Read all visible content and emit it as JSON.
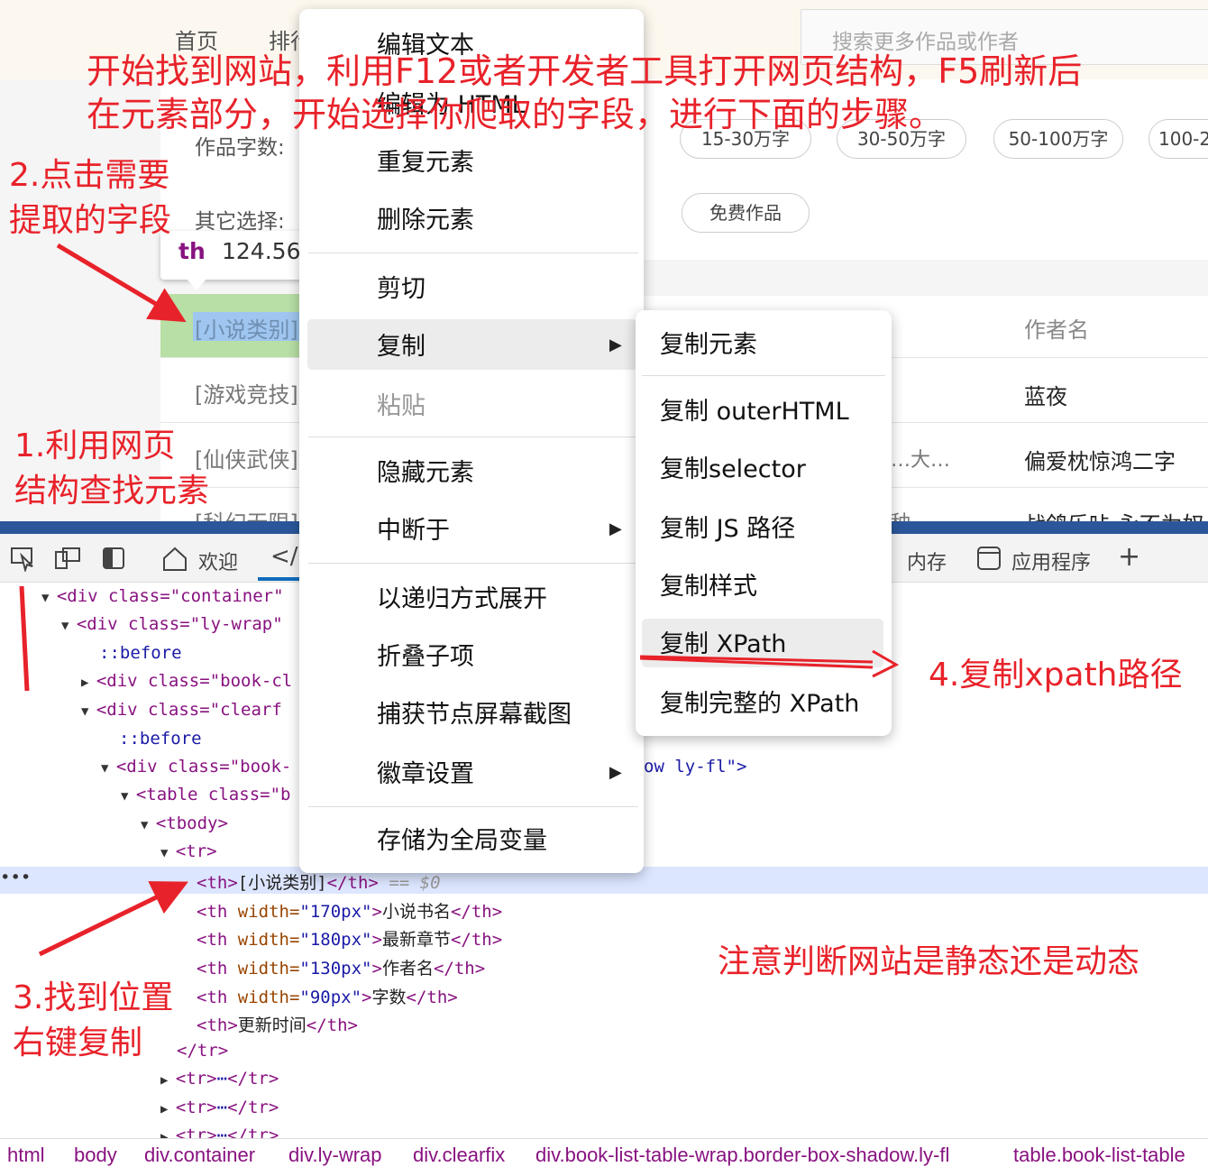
{
  "webpage": {
    "nav": [
      "首页",
      "排行"
    ],
    "search_placeholder": "搜索更多作品或作者",
    "filter_word_count_label": "作品字数:",
    "filter_other_label": "其它选择:",
    "word_count_pills": [
      "15-30万字",
      "30-50万字",
      "50-100万字",
      "100-2"
    ],
    "other_pills": [
      "免费作品"
    ],
    "tooltip_tag": "th",
    "tooltip_size": "124.56",
    "table_header_category": "[小说类别]",
    "table_header_author": "作者名",
    "categories": [
      "[游戏竞技]",
      "[仙侠武侠]",
      "[科幻无限]"
    ],
    "authors": [
      "蓝夜",
      "偏爱枕惊鸿二字",
      "战鸽乐咔 永不为奴"
    ],
    "truncated_text": "…大…",
    "partial_text": "种"
  },
  "context_menu": {
    "items": [
      "编辑文本",
      "编辑为 HTML",
      "重复元素",
      "删除元素",
      "剪切",
      "复制",
      "粘贴",
      "隐藏元素",
      "中断于",
      "以递归方式展开",
      "折叠子项",
      "捕获节点屏幕截图",
      "徽章设置",
      "存储为全局变量"
    ],
    "submenu_arrow": "▶"
  },
  "copy_submenu": {
    "items": [
      "复制元素",
      "复制 outerHTML",
      "复制selector",
      "复制 JS 路径",
      "复制样式",
      "复制 XPath",
      "复制完整的 XPath"
    ]
  },
  "devtools": {
    "tabs": [
      "欢迎",
      "内存",
      "应用程序"
    ],
    "code_tab_icon": "</>",
    "add_tab": "+",
    "selected_suffix": "== $0",
    "lines": {
      "container": "<div class=\"container\"",
      "lywrap": "<div class=\"ly-wrap\"",
      "before1": "::before",
      "bookc": "<div class=\"book-cl",
      "clearf": "<div class=\"clearf",
      "before2": "::before",
      "book": "<div class=\"book-",
      "book_rest": "ow ly-fl\">",
      "table": "<table class=\"b",
      "tbody": "<tbody>",
      "tr": "<tr>",
      "th_sel": "[小说类别]",
      "th2_text": "小说书名",
      "th2_w": "\"170px\"",
      "th3_text": "最新章节",
      "th3_w": "\"180px\"",
      "th4_text": "作者名",
      "th4_w": "\"130px\"",
      "th5_text": "字数",
      "th5_w": "\"90px\"",
      "th6_text": "更新时间",
      "tr_close": "</tr>"
    },
    "breadcrumb": [
      "html",
      "body",
      "div.container",
      "div.ly-wrap",
      "div.clearfix",
      "div.book-list-table-wrap.border-box-shadow.ly-fl",
      "table.book-list-table"
    ]
  },
  "annotations": {
    "top_line1": "开始找到网站，利用F12或者开发者工具打开网页结构，F5刷新后",
    "top_line2": "在元素部分，开始选择你爬取的字段，进行下面的步骤。",
    "step2_line1": "2.点击需要",
    "step2_line2": "提取的字段",
    "step1_line1": "1.利用网页",
    "step1_line2": "结构查找元素",
    "step3_line1": "3.找到位置",
    "step3_line2": "右键复制",
    "step4": "4.复制xpath路径",
    "note": "注意判断网站是静态还是动态"
  },
  "colors": {
    "annotation": "#e8222a",
    "tag": "#881280",
    "attr": "#994500",
    "value": "#1a1aa6",
    "highlight_green": "#b8dfa5",
    "highlight_blue": "#9fc6f0",
    "selected_row": "#dde6ff"
  }
}
